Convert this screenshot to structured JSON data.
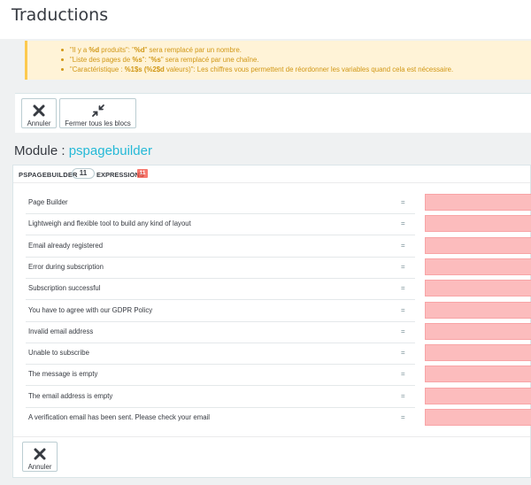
{
  "page": {
    "title": "Traductions"
  },
  "alert": {
    "items": [
      {
        "parts": [
          {
            "t": "\"Il y a ",
            "b": false
          },
          {
            "t": "%d",
            "b": true
          },
          {
            "t": " produits\": \"",
            "b": false
          },
          {
            "t": "%d",
            "b": true
          },
          {
            "t": "\" sera remplacé par un nombre.",
            "b": false
          }
        ]
      },
      {
        "parts": [
          {
            "t": "\"Liste des pages de ",
            "b": false
          },
          {
            "t": "%s",
            "b": true
          },
          {
            "t": "\": \"",
            "b": false
          },
          {
            "t": "%s",
            "b": true
          },
          {
            "t": "\" sera remplacé par une chaîne.",
            "b": false
          }
        ]
      },
      {
        "parts": [
          {
            "t": "\"Caractéristique : ",
            "b": false
          },
          {
            "t": "%1$s",
            "b": true
          },
          {
            "t": " ",
            "b": false
          },
          {
            "t": "(%2$d",
            "b": true
          },
          {
            "t": " valeurs)\": Les chiffres vous permettent de réordonner les variables quand cela est nécessaire.",
            "b": false
          }
        ]
      }
    ]
  },
  "toolbar": {
    "cancel_label": "Annuler",
    "collapse_label": "Fermer tous les blocs"
  },
  "module": {
    "prefix": "Module : ",
    "name": "pspagebuilder"
  },
  "panel": {
    "module_code": "PSPAGEBUILDER",
    "count": "11",
    "expressions_label": "EXPRESSIONS",
    "missing_count": "11",
    "equals": "=",
    "rows": [
      "Page Builder",
      "Lightweigh and flexible tool to build any kind of layout",
      "Email already registered",
      "Error during subscription",
      "Subscription successful",
      "You have to agree with our GDPR Policy",
      "Invalid email address",
      "Unable to subscribe",
      "The message is empty",
      "The email address is empty",
      "A verification email has been sent. Please check your email"
    ],
    "footer_cancel_label": "Annuler"
  },
  "colors": {
    "accent": "#25b9d7",
    "missing_field": "#fcbcbd",
    "alert_text": "#d19715",
    "alert_bg": "#fff3d7"
  }
}
